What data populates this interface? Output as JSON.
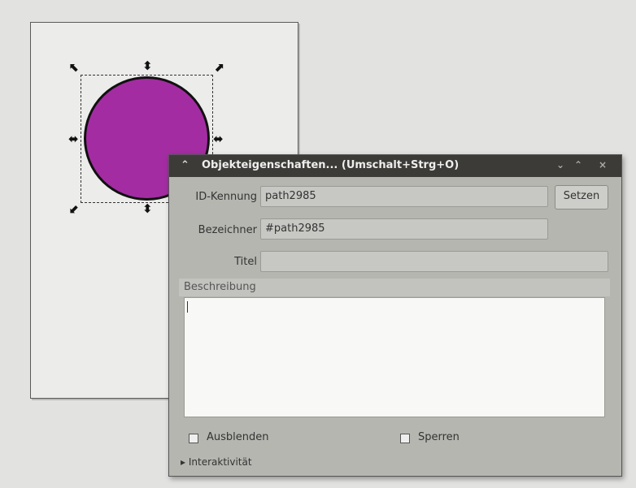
{
  "dialog": {
    "title": "Objekteigenschaften... (Umschalt+Strg+O)",
    "id_label": "ID-Kennung",
    "id_value": "path2985",
    "set_button": "Setzen",
    "label_label": "Bezeichner",
    "label_value": "#path2985",
    "title_label": "Titel",
    "title_value": "",
    "description_label": "Beschreibung",
    "description_value": "",
    "hide_label": "Ausblenden",
    "lock_label": "Sperren",
    "interactivity_label": "Interaktivität"
  },
  "icons": {
    "title_icon": "chevron-up-icon",
    "minimize": "minimize-icon",
    "maximize": "maximize-icon",
    "close": "close-icon"
  },
  "colors": {
    "circle_fill": "#a42ca2",
    "titlebar": "#3c3b37",
    "dialog_bg": "#b6b6b1"
  }
}
